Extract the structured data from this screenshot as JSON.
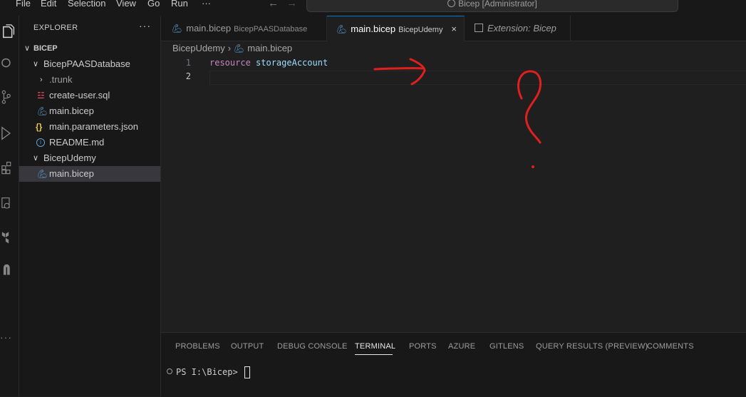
{
  "menu": {
    "items": [
      "File",
      "Edit",
      "Selection",
      "View",
      "Go",
      "Run",
      "···"
    ]
  },
  "title": {
    "command_center": "Bicep [Administrator]"
  },
  "explorer": {
    "title": "EXPLORER",
    "more": "···",
    "root": "BICEP",
    "tree": [
      {
        "label": "BicepPAASDatabase",
        "kind": "folder-open"
      },
      {
        "label": ".trunk",
        "kind": "folder-closed"
      },
      {
        "label": "create-user.sql",
        "kind": "sql"
      },
      {
        "label": "main.bicep",
        "kind": "bicep"
      },
      {
        "label": "main.parameters.json",
        "kind": "json"
      },
      {
        "label": "README.md",
        "kind": "info"
      },
      {
        "label": "BicepUdemy",
        "kind": "folder-open"
      },
      {
        "label": "main.bicep",
        "kind": "bicep",
        "selected": true
      }
    ]
  },
  "tabs": [
    {
      "label": "main.bicep",
      "description": "BicepPAASDatabase",
      "active": false
    },
    {
      "label": "main.bicep",
      "description": "BicepUdemy",
      "active": true,
      "close": "×"
    },
    {
      "label": "Extension: Bicep",
      "description": "",
      "active": false
    }
  ],
  "breadcrumb": {
    "folder": "BicepUdemy",
    "separator": "›",
    "file": "main.bicep"
  },
  "editor": {
    "line_numbers": [
      "1",
      "2"
    ],
    "line1_keyword": "resource",
    "line1_identifier": "storageAccount"
  },
  "panel": {
    "tabs": [
      "PROBLEMS",
      "OUTPUT",
      "DEBUG CONSOLE",
      "TERMINAL",
      "PORTS",
      "AZURE",
      "GITLENS",
      "QUERY RESULTS (PREVIEW)",
      "COMMENTS"
    ],
    "active_tab": "TERMINAL",
    "terminal_prompt": "PS I:\\Bicep> "
  },
  "colors": {
    "annotation_red": "#e0201e",
    "accent": "#0078d4",
    "keyword": "#c586c0",
    "identifier": "#9cdcfe"
  }
}
